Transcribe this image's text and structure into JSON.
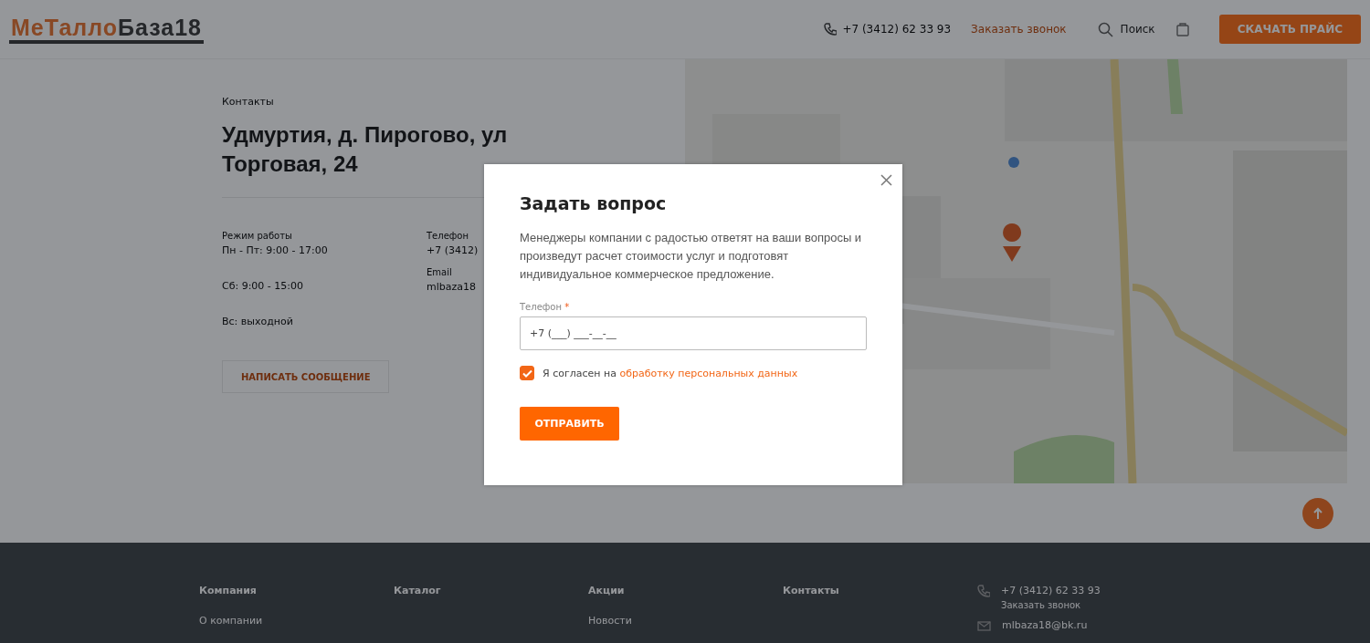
{
  "header": {
    "logo": {
      "accent": "МеТалло",
      "main": "База18"
    },
    "phone": "+7 (3412) 62 33 93",
    "callback": "Заказать звонок",
    "search": "Поиск",
    "price_button": "СКАЧАТЬ ПРАЙС"
  },
  "contacts": {
    "breadcrumb": "Контакты",
    "address": "Удмуртия, д. Пирогово, ул Торговая, 24",
    "hours_label": "Режим работы",
    "hours": [
      "Пн - Пт: 9:00 - 17:00",
      "Сб: 9:00 - 15:00",
      "Вс: выходной"
    ],
    "phone_label": "Телефон",
    "phone": "+7 (3412)",
    "email_label": "Email",
    "email": "mlbaza18",
    "message_button": "НАПИСАТЬ СООБЩЕНИЕ",
    "map": {
      "kind": "picture"
    }
  },
  "footer": {
    "columns": [
      {
        "title": "Компания",
        "links": [
          "О компании"
        ]
      },
      {
        "title": "Каталог"
      },
      {
        "title": "Акции",
        "links": [
          "Новости"
        ]
      },
      {
        "title": "Контакты"
      }
    ],
    "phone": "+7 (3412) 62 33 93",
    "callback": "Заказать звонок",
    "email": "mlbaza18@bk.ru"
  },
  "modal": {
    "title": "Задать вопрос",
    "description": "Менеджеры компании с радостью ответят на ваши вопросы и произведут расчет стоимости услуг и подготовят индивидуальное коммерческое предложение.",
    "phone_field": {
      "label": "Телефон",
      "required_mark": "*",
      "value": "+7 (___) ___-__-__"
    },
    "consent": {
      "checked": true,
      "text": "Я согласен на ",
      "link": "обработку персональных данных"
    },
    "submit": "ОТПРАВИТЬ"
  }
}
